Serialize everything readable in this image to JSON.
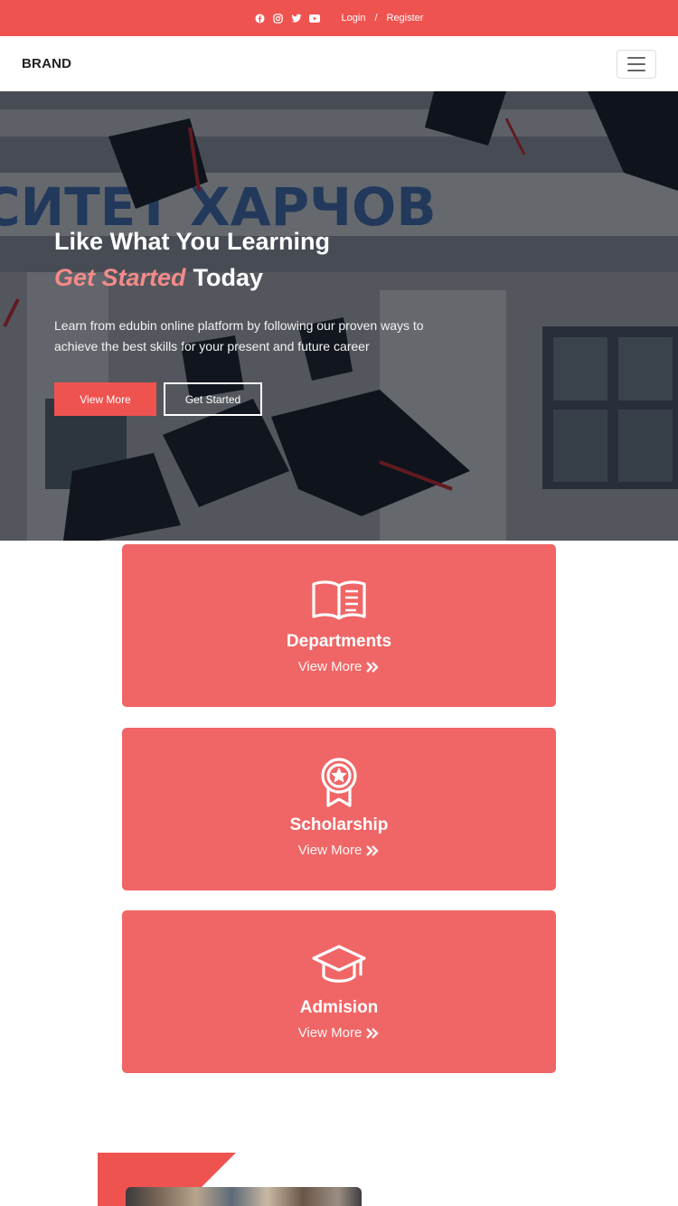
{
  "topbar": {
    "social_icons": [
      "facebook-icon",
      "instagram-icon",
      "twitter-icon",
      "youtube-icon"
    ],
    "login_label": "Login",
    "separator": "/",
    "register_label": "Register"
  },
  "navbar": {
    "brand": "BRAND",
    "toggle_icon": "hamburger-icon"
  },
  "hero": {
    "title_line1": "Like What You Learning",
    "title_accent": "Get Started",
    "title_rest": "Today",
    "text": "Learn from edubin online platform by following our proven ways to achieve the best skills for your present and future career",
    "primary_button": "View More",
    "secondary_button": "Get Started"
  },
  "cards": [
    {
      "icon": "open-book-icon",
      "title": "Departments",
      "link": "View More"
    },
    {
      "icon": "award-badge-icon",
      "title": "Scholarship",
      "link": "View More"
    },
    {
      "icon": "graduation-cap-icon",
      "title": "Admision",
      "link": "View More"
    }
  ],
  "colors": {
    "accent": "#ef5350",
    "card": "#f06666",
    "accent_text": "#f48a8a"
  }
}
